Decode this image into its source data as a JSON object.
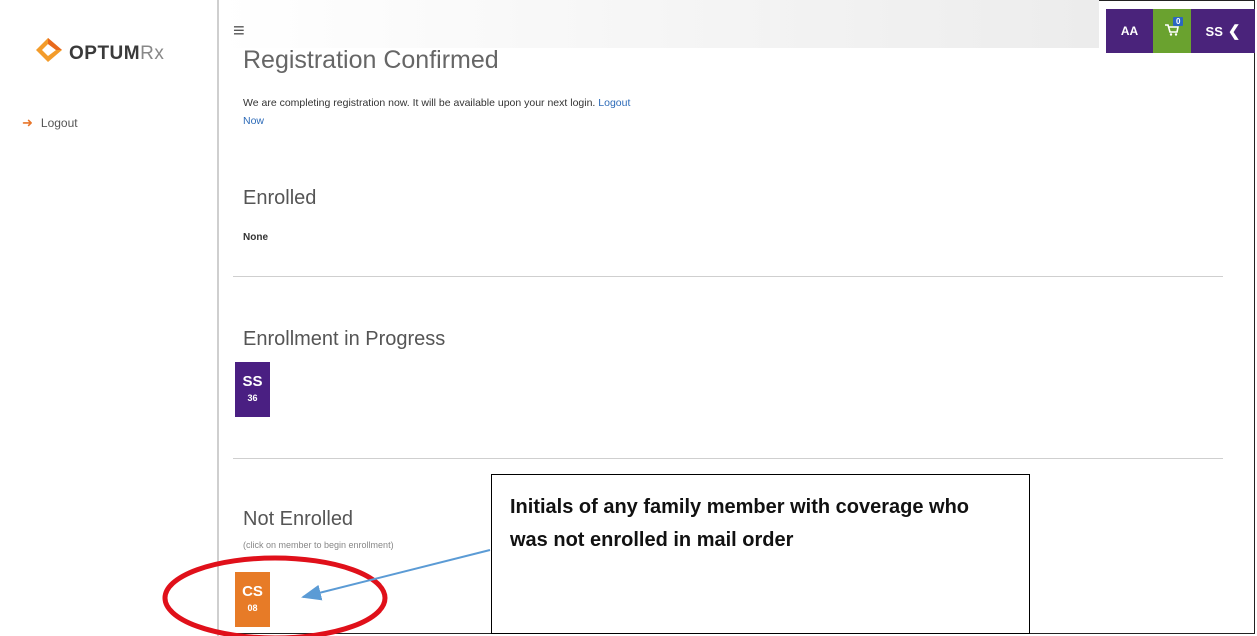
{
  "sidebar": {
    "logo_text_bold": "OPTUM",
    "logo_text_rx": "Rx",
    "logout_label": "Logout"
  },
  "topbar": {
    "text_size_label": "AA",
    "cart_count": "0",
    "user_initials": "SS",
    "colors": {
      "purple": "#4a237b",
      "green": "#6aa22f"
    }
  },
  "main": {
    "title": "Registration Confirmed",
    "message": "We are completing registration now. It will be available upon your next login.",
    "logout_link_1": "Logout",
    "logout_link_2": "Now",
    "enrolled": {
      "heading": "Enrolled",
      "value": "None"
    },
    "in_progress": {
      "heading": "Enrollment in Progress",
      "members": [
        {
          "initials": "SS",
          "age": "36"
        }
      ]
    },
    "not_enrolled": {
      "heading": "Not Enrolled",
      "hint": "(click on member to begin enrollment)",
      "members": [
        {
          "initials": "CS",
          "age": "08"
        }
      ]
    }
  },
  "callout": {
    "text": "Initials of any family member with coverage who was not enrolled in mail order"
  }
}
